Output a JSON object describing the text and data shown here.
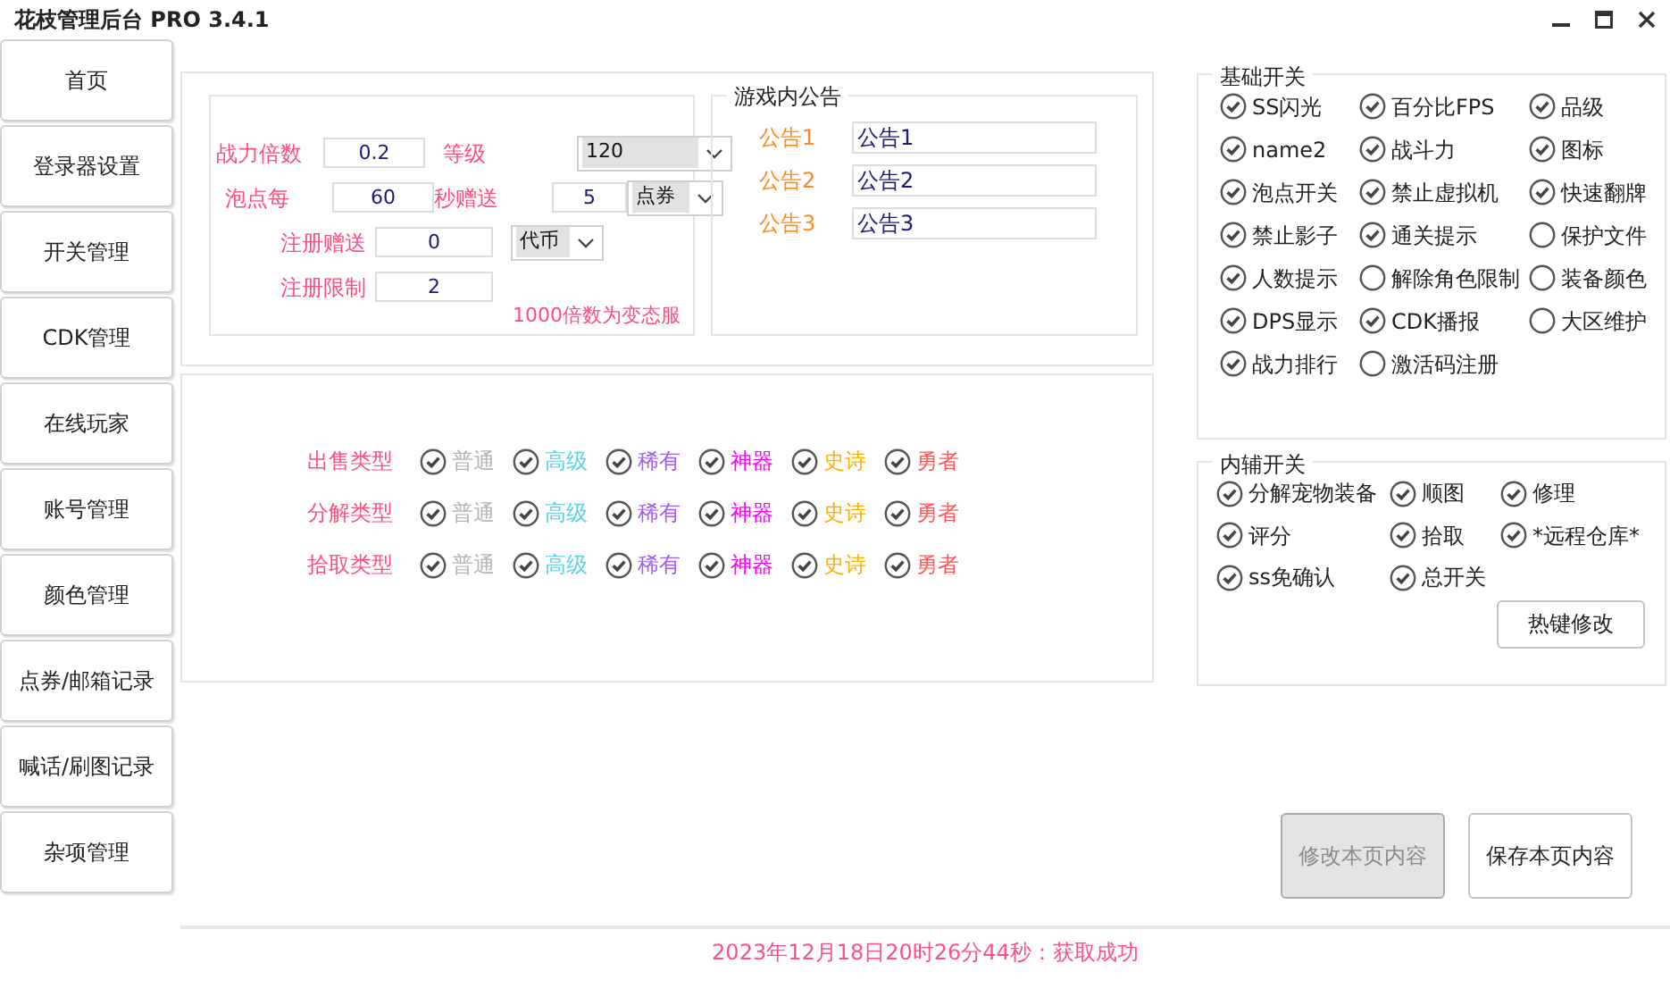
{
  "window": {
    "title": "花枝管理后台 PRO 3.4.1"
  },
  "sidebar": {
    "items": [
      {
        "label": "首页"
      },
      {
        "label": "登录器设置"
      },
      {
        "label": "开关管理"
      },
      {
        "label": "CDK管理"
      },
      {
        "label": "在线玩家"
      },
      {
        "label": "账号管理"
      },
      {
        "label": "颜色管理"
      },
      {
        "label": "点券/邮箱记录"
      },
      {
        "label": "喊话/刷图记录"
      },
      {
        "label": "杂项管理"
      }
    ]
  },
  "settings": {
    "rows": [
      [
        {
          "kind": "label",
          "text": "战力倍数"
        },
        {
          "kind": "input",
          "value": "0.2"
        },
        {
          "kind": "label",
          "text": "等级"
        },
        {
          "kind": "select",
          "value": "120"
        }
      ],
      [
        {
          "kind": "label",
          "text": "泡点每"
        },
        {
          "kind": "input",
          "value": "60"
        },
        {
          "kind": "label",
          "text": "秒赠送"
        },
        {
          "kind": "input",
          "value": "5"
        },
        {
          "kind": "select",
          "value": "点券"
        }
      ],
      [
        {
          "kind": "label",
          "text": "注册赠送"
        },
        {
          "kind": "input",
          "value": "0"
        },
        {
          "kind": "select",
          "value": "代币"
        }
      ],
      [
        {
          "kind": "label",
          "text": "注册限制"
        },
        {
          "kind": "input",
          "value": "2"
        }
      ]
    ],
    "note": "1000倍数为变态服"
  },
  "announcements": {
    "title": "游戏内公告",
    "items": [
      {
        "label": "公告1",
        "value": "公告1"
      },
      {
        "label": "公告2",
        "value": "公告2"
      },
      {
        "label": "公告3",
        "value": "公告3"
      }
    ]
  },
  "rarity_rows": [
    {
      "label": "出售类型",
      "options": [
        {
          "label": "普通",
          "checked": true,
          "color": "#b4b4b4"
        },
        {
          "label": "高级",
          "checked": true,
          "color": "#5bd0e8"
        },
        {
          "label": "稀有",
          "checked": true,
          "color": "#a25ef0"
        },
        {
          "label": "神器",
          "checked": true,
          "color": "#ff00ff"
        },
        {
          "label": "史诗",
          "checked": true,
          "color": "#ffb000"
        },
        {
          "label": "勇者",
          "checked": true,
          "color": "#ff5a5a"
        }
      ]
    },
    {
      "label": "分解类型",
      "options": [
        {
          "label": "普通",
          "checked": true,
          "color": "#b4b4b4"
        },
        {
          "label": "高级",
          "checked": true,
          "color": "#5bd0e8"
        },
        {
          "label": "稀有",
          "checked": true,
          "color": "#a25ef0"
        },
        {
          "label": "神器",
          "checked": true,
          "color": "#ff00ff"
        },
        {
          "label": "史诗",
          "checked": true,
          "color": "#ffb000"
        },
        {
          "label": "勇者",
          "checked": true,
          "color": "#ff5a5a"
        }
      ]
    },
    {
      "label": "拾取类型",
      "options": [
        {
          "label": "普通",
          "checked": true,
          "color": "#b4b4b4"
        },
        {
          "label": "高级",
          "checked": true,
          "color": "#5bd0e8"
        },
        {
          "label": "稀有",
          "checked": true,
          "color": "#a25ef0"
        },
        {
          "label": "神器",
          "checked": true,
          "color": "#ff00ff"
        },
        {
          "label": "史诗",
          "checked": true,
          "color": "#ffb000"
        },
        {
          "label": "勇者",
          "checked": true,
          "color": "#ff5a5a"
        }
      ]
    }
  ],
  "basic_switches": {
    "title": "基础开关",
    "items": [
      {
        "label": "SS闪光",
        "checked": true
      },
      {
        "label": "百分比FPS",
        "checked": true
      },
      {
        "label": "品级",
        "checked": true
      },
      {
        "label": "name2",
        "checked": true
      },
      {
        "label": "战斗力",
        "checked": true
      },
      {
        "label": "图标",
        "checked": true
      },
      {
        "label": "泡点开关",
        "checked": true
      },
      {
        "label": "禁止虚拟机",
        "checked": true
      },
      {
        "label": "快速翻牌",
        "checked": true
      },
      {
        "label": "禁止影子",
        "checked": true
      },
      {
        "label": "通关提示",
        "checked": true
      },
      {
        "label": "保护文件",
        "checked": false
      },
      {
        "label": "人数提示",
        "checked": true
      },
      {
        "label": "解除角色限制",
        "checked": false
      },
      {
        "label": "装备颜色",
        "checked": false
      },
      {
        "label": "DPS显示",
        "checked": true
      },
      {
        "label": "CDK播报",
        "checked": true
      },
      {
        "label": "大区维护",
        "checked": false
      },
      {
        "label": "战力排行",
        "checked": true
      },
      {
        "label": "激活码注册",
        "checked": false
      }
    ]
  },
  "assist_switches": {
    "title": "内辅开关",
    "items": [
      {
        "label": "分解宠物装备",
        "checked": true
      },
      {
        "label": "顺图",
        "checked": true
      },
      {
        "label": "修理",
        "checked": true
      },
      {
        "label": "评分",
        "checked": true
      },
      {
        "label": "拾取",
        "checked": true
      },
      {
        "label": "*远程仓库*",
        "checked": true
      },
      {
        "label": "ss免确认",
        "checked": true
      },
      {
        "label": "总开关",
        "checked": true
      }
    ],
    "button": "热键修改"
  },
  "buttons": [
    {
      "label": "修改本页内容",
      "disabled": true
    },
    {
      "label": "保存本页内容",
      "disabled": false
    }
  ],
  "status": "2023年12月18日20时26分44秒：获取成功"
}
